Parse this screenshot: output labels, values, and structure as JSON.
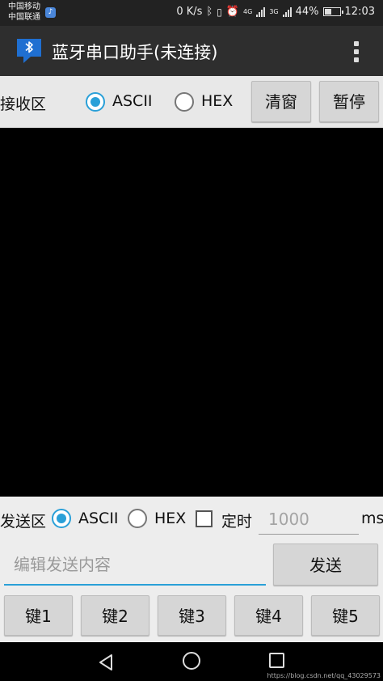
{
  "status_bar": {
    "carrier_1": "中国移动",
    "carrier_2": "中国联通",
    "net_speed": "0 K/s",
    "network_1": "4G",
    "network_2": "3G",
    "battery_percent": "44%",
    "battery_level": 0.44,
    "time": "12:03"
  },
  "app_bar": {
    "title": "蓝牙串口助手(未连接)"
  },
  "receive": {
    "label": "接收区",
    "mode_ascii": "ASCII",
    "mode_hex": "HEX",
    "selected_mode": "ASCII",
    "clear_button": "清窗",
    "pause_button": "暂停",
    "content": ""
  },
  "send": {
    "label": "发送区",
    "mode_ascii": "ASCII",
    "mode_hex": "HEX",
    "selected_mode": "ASCII",
    "timer_label": "定时",
    "timer_checked": false,
    "interval_placeholder": "1000",
    "interval_unit": "ms",
    "input_placeholder": "编辑发送内容",
    "send_button": "发送",
    "keys": [
      "键1",
      "键2",
      "键3",
      "键4",
      "键5"
    ]
  },
  "footer": {
    "watermark": "https://blog.csdn.net/qq_43029573"
  },
  "colors": {
    "accent": "#2aa0d8",
    "app_bar": "#2e2e2e",
    "button": "#d6d6d6",
    "receive_area": "#000000"
  }
}
